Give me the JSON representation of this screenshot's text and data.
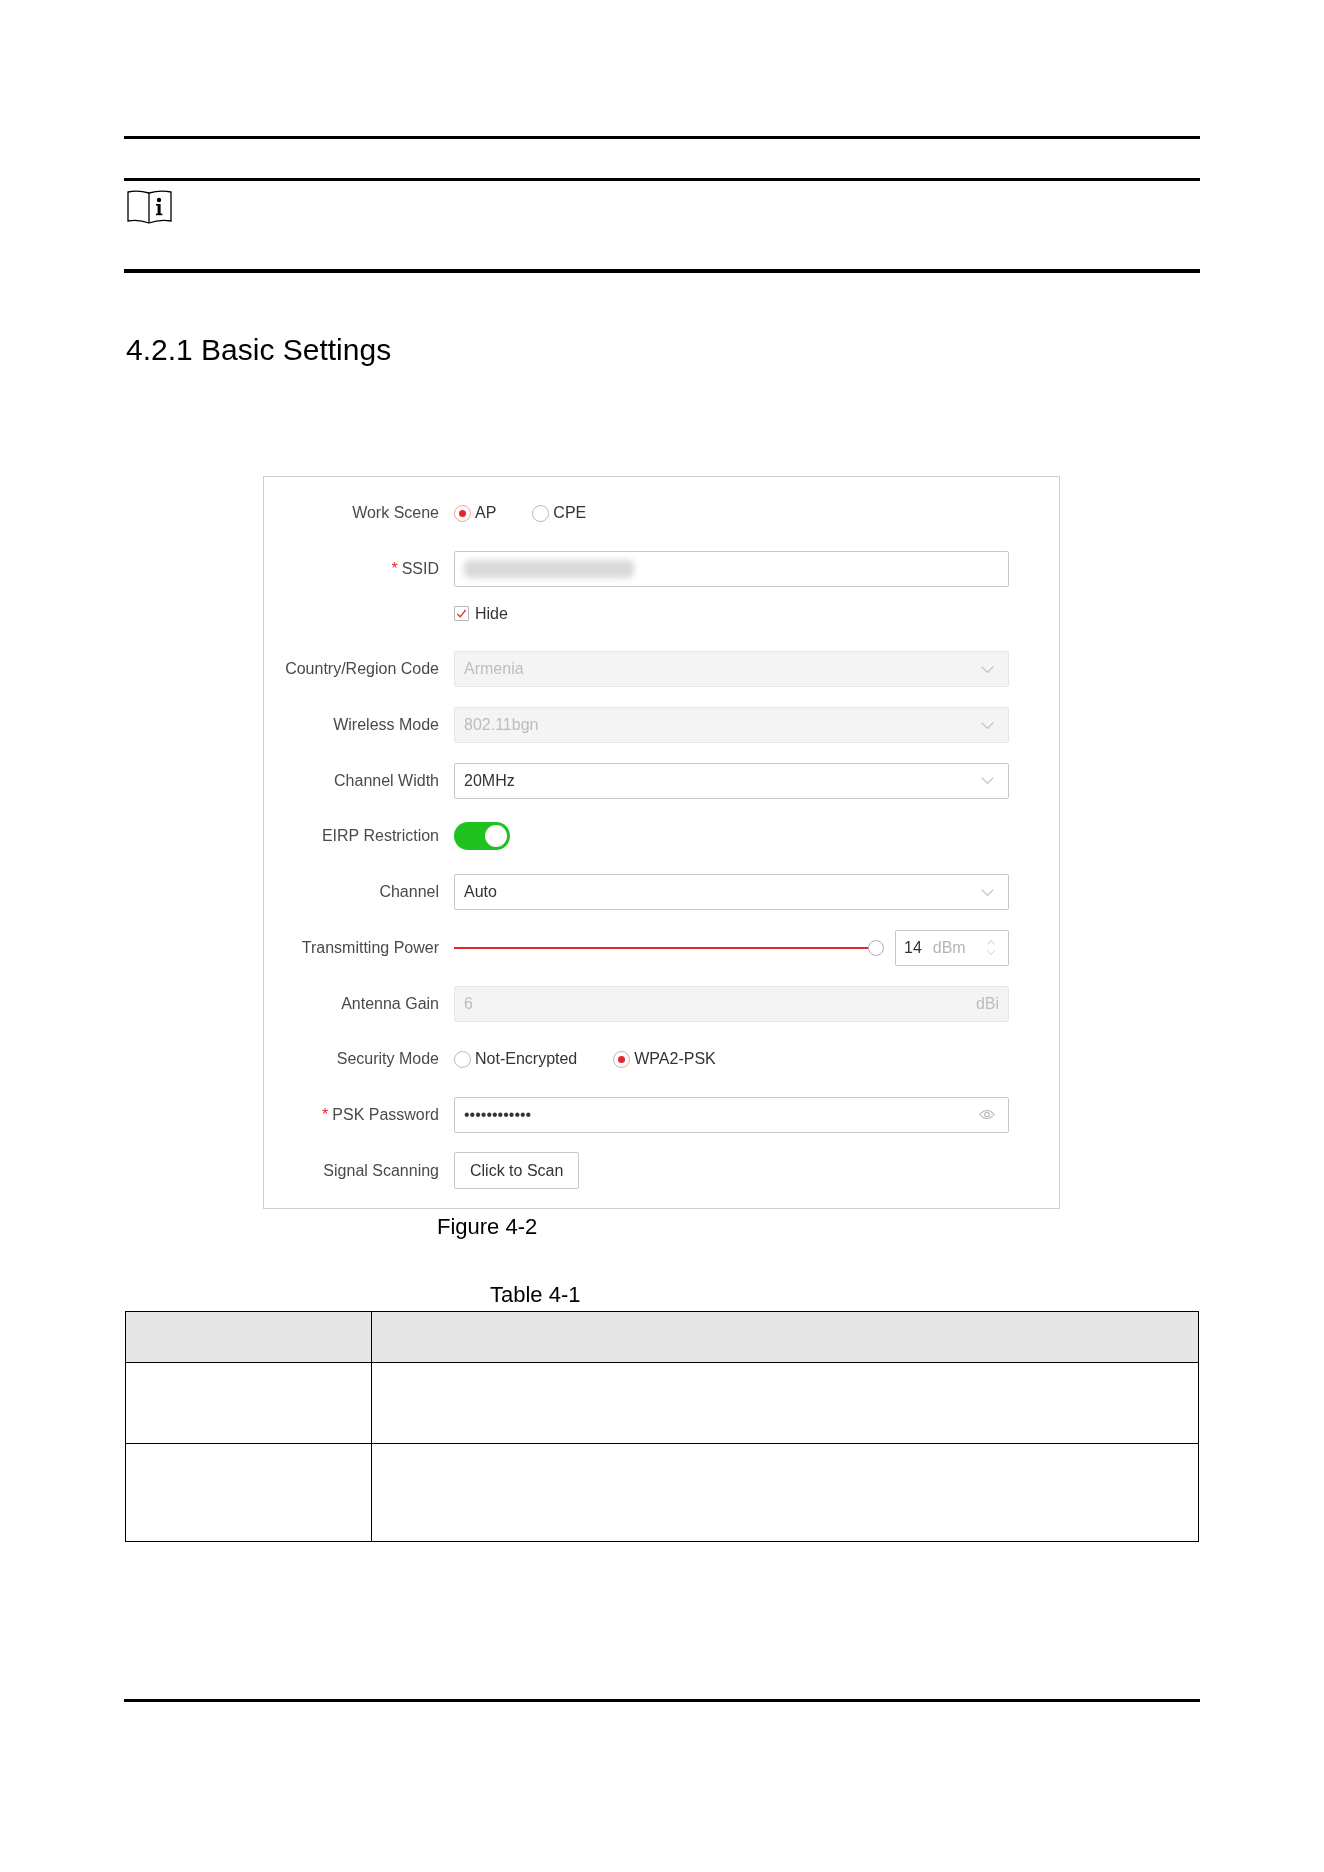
{
  "heading": "4.2.1 Basic Settings",
  "figure": {
    "caption": "Figure 4-2",
    "form": {
      "rows": [
        {
          "kind": "radio",
          "label": "Work Scene",
          "options": [
            {
              "label": "AP",
              "selected": true
            },
            {
              "label": "CPE",
              "selected": false
            }
          ]
        },
        {
          "kind": "text",
          "label": "SSID",
          "asterisk": "*",
          "value_blurred": true,
          "disabled": false
        },
        {
          "kind": "checkbox",
          "option": "Hide",
          "checked": true
        },
        {
          "kind": "select",
          "label": "Country/Region Code",
          "value": "Armenia",
          "disabled": true
        },
        {
          "kind": "select",
          "label": "Wireless Mode",
          "value": "802.11bgn",
          "disabled": true
        },
        {
          "kind": "select",
          "label": "Channel Width",
          "value": "20MHz",
          "disabled": false
        },
        {
          "kind": "switch",
          "label": "EIRP Restriction",
          "on": true
        },
        {
          "kind": "select",
          "label": "Channel",
          "value": "Auto",
          "disabled": false
        },
        {
          "kind": "slider",
          "label": "Transmitting Power",
          "level": 1,
          "value": "14",
          "unit": "dBm"
        },
        {
          "kind": "text",
          "label": "Antenna Gain",
          "value": "6",
          "unit": "dBi",
          "disabled": true
        },
        {
          "kind": "radio",
          "label": "Security Mode",
          "options": [
            {
              "label": "Not-Encrypted",
              "selected": false
            },
            {
              "label": "WPA2-PSK",
              "selected": true
            }
          ]
        },
        {
          "kind": "password",
          "label": "PSK Password",
          "asterisk": "*",
          "value": "••••••••••••"
        },
        {
          "kind": "button",
          "label": "Signal Scanning",
          "button": "Click to Scan"
        }
      ]
    }
  },
  "table": {
    "caption": "Table 4-1"
  }
}
